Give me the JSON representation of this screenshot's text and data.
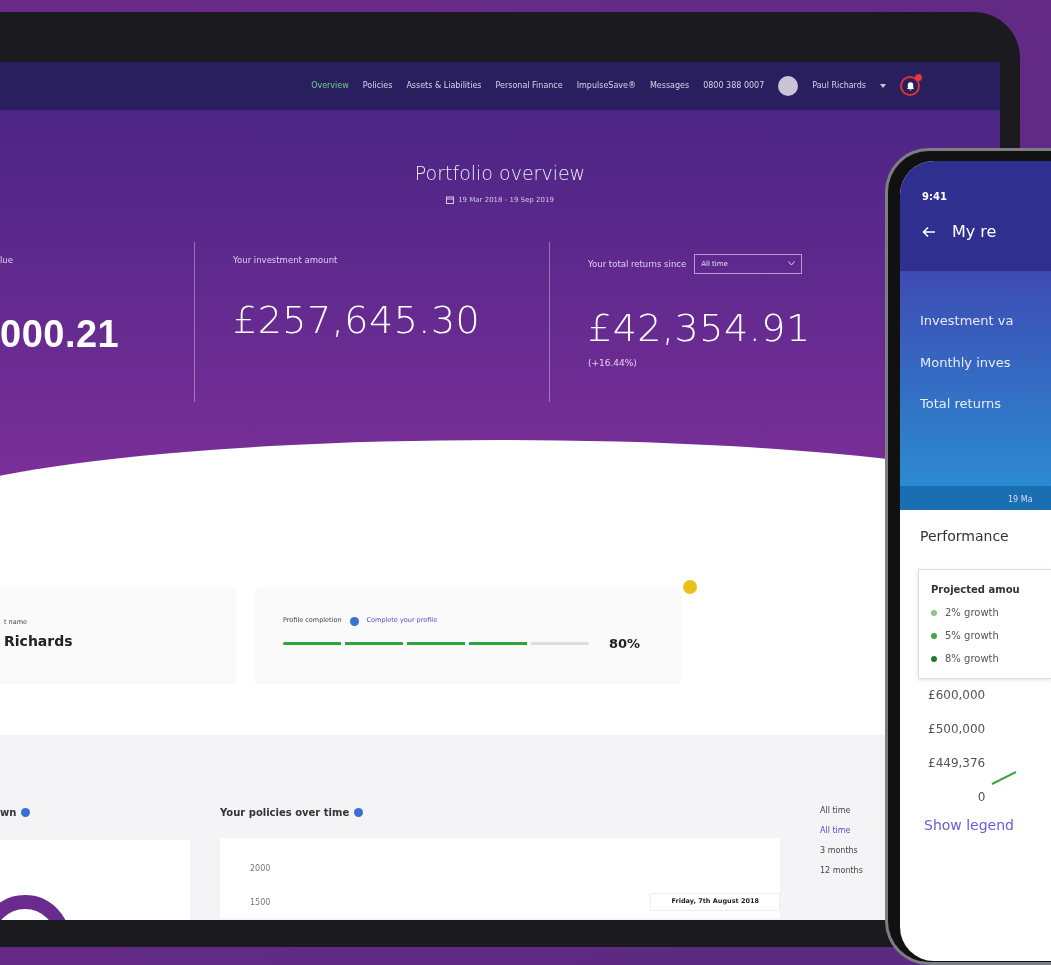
{
  "tablet": {
    "nav": {
      "items": [
        {
          "label": "Overview",
          "selected": true
        },
        {
          "label": "Policies",
          "selected": false
        },
        {
          "label": "Assets & Liabilities",
          "selected": false
        },
        {
          "label": "Personal Finance",
          "selected": false
        },
        {
          "label": "ImpulseSave®",
          "selected": false
        },
        {
          "label": "Messages",
          "selected": false
        }
      ],
      "phone": "0800 388 0007",
      "user": "Paul Richards",
      "notification": true
    },
    "hero": {
      "title": "Portfolio overview",
      "date_range": "19 Mar 2018 - 19 Sep 2019",
      "stats": [
        {
          "label": "lue",
          "value": "000.21"
        },
        {
          "label": "Your investment amount",
          "value": "£257,645.30"
        },
        {
          "label": "Your total returns since",
          "value": "£42,354.91",
          "change": "(+16.44%)",
          "select": "All time"
        }
      ]
    },
    "name_card": {
      "label": "t name",
      "value": "Richards"
    },
    "profile": {
      "label": "Profile completion",
      "link": "Complete your profile",
      "level": 0.8,
      "reading": "80%",
      "alert": true
    },
    "section": {
      "left_title": "wn",
      "title": "Your policies over time",
      "y_labels": [
        "2000",
        "1500"
      ],
      "tooltip": "Friday, 7th August 2018",
      "range_select": "All time",
      "ranges": [
        {
          "label": "All time",
          "selected": true
        },
        {
          "label": "3 months",
          "selected": false
        },
        {
          "label": "12 months",
          "selected": false
        }
      ]
    }
  },
  "phone": {
    "time": "9:41",
    "title": "My re",
    "rows": [
      "Investment va",
      "Monthly inves",
      "Total returns"
    ],
    "date": "19 Ma",
    "performance": "Performance",
    "legend": {
      "title": "Projected amou",
      "items": [
        {
          "label": "2% growth",
          "color": "#8bc48a"
        },
        {
          "label": "5% growth",
          "color": "#3fa548"
        },
        {
          "label": "8% growth",
          "color": "#1e7d32"
        }
      ]
    },
    "y_labels": [
      "£600,000",
      "£500,000",
      "£449,376",
      "0"
    ],
    "link": "Show legend"
  }
}
